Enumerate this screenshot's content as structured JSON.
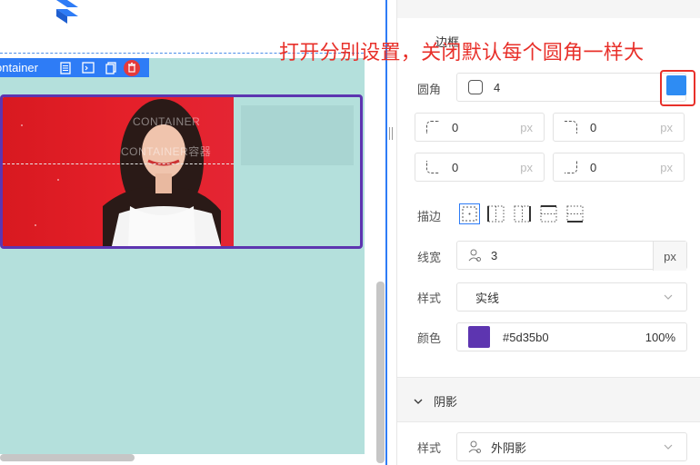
{
  "canvas": {
    "toolbar": {
      "label": "ontainer",
      "icons": [
        "document-icon",
        "code-icon",
        "copy-icon",
        "delete-icon"
      ]
    },
    "banner": {
      "placeholder_1": "CONTAINER",
      "placeholder_2": "CONTAINER容器"
    }
  },
  "panel": {
    "section_title": "边框",
    "radius": {
      "label": "圆角",
      "value": "4",
      "separate_toggle": true,
      "corners": [
        {
          "name": "top-left",
          "value": "0",
          "unit": "px"
        },
        {
          "name": "top-right",
          "value": "0",
          "unit": "px"
        },
        {
          "name": "bottom-left",
          "value": "0",
          "unit": "px"
        },
        {
          "name": "bottom-right",
          "value": "0",
          "unit": "px"
        }
      ]
    },
    "stroke": {
      "label": "描边",
      "options": [
        "all-sides",
        "left-right",
        "top-bottom-sides",
        "top-bottom",
        "bottom"
      ],
      "selected": "all-sides"
    },
    "width": {
      "label": "线宽",
      "value": "3",
      "unit": "px"
    },
    "style": {
      "label": "样式",
      "value": "实线"
    },
    "color": {
      "label": "颜色",
      "hex": "#5d35b0",
      "opacity": "100%"
    },
    "shadow": {
      "title": "阴影",
      "style_label": "样式",
      "style_value": "外阴影"
    }
  },
  "annotation": "打开分别设置，关闭默认每个圆角一样大",
  "colors": {
    "accent": "#2e7cf6",
    "border_color": "#5d35b0",
    "annotation": "#e8302a",
    "canvas_bg": "#b4e0dc"
  }
}
